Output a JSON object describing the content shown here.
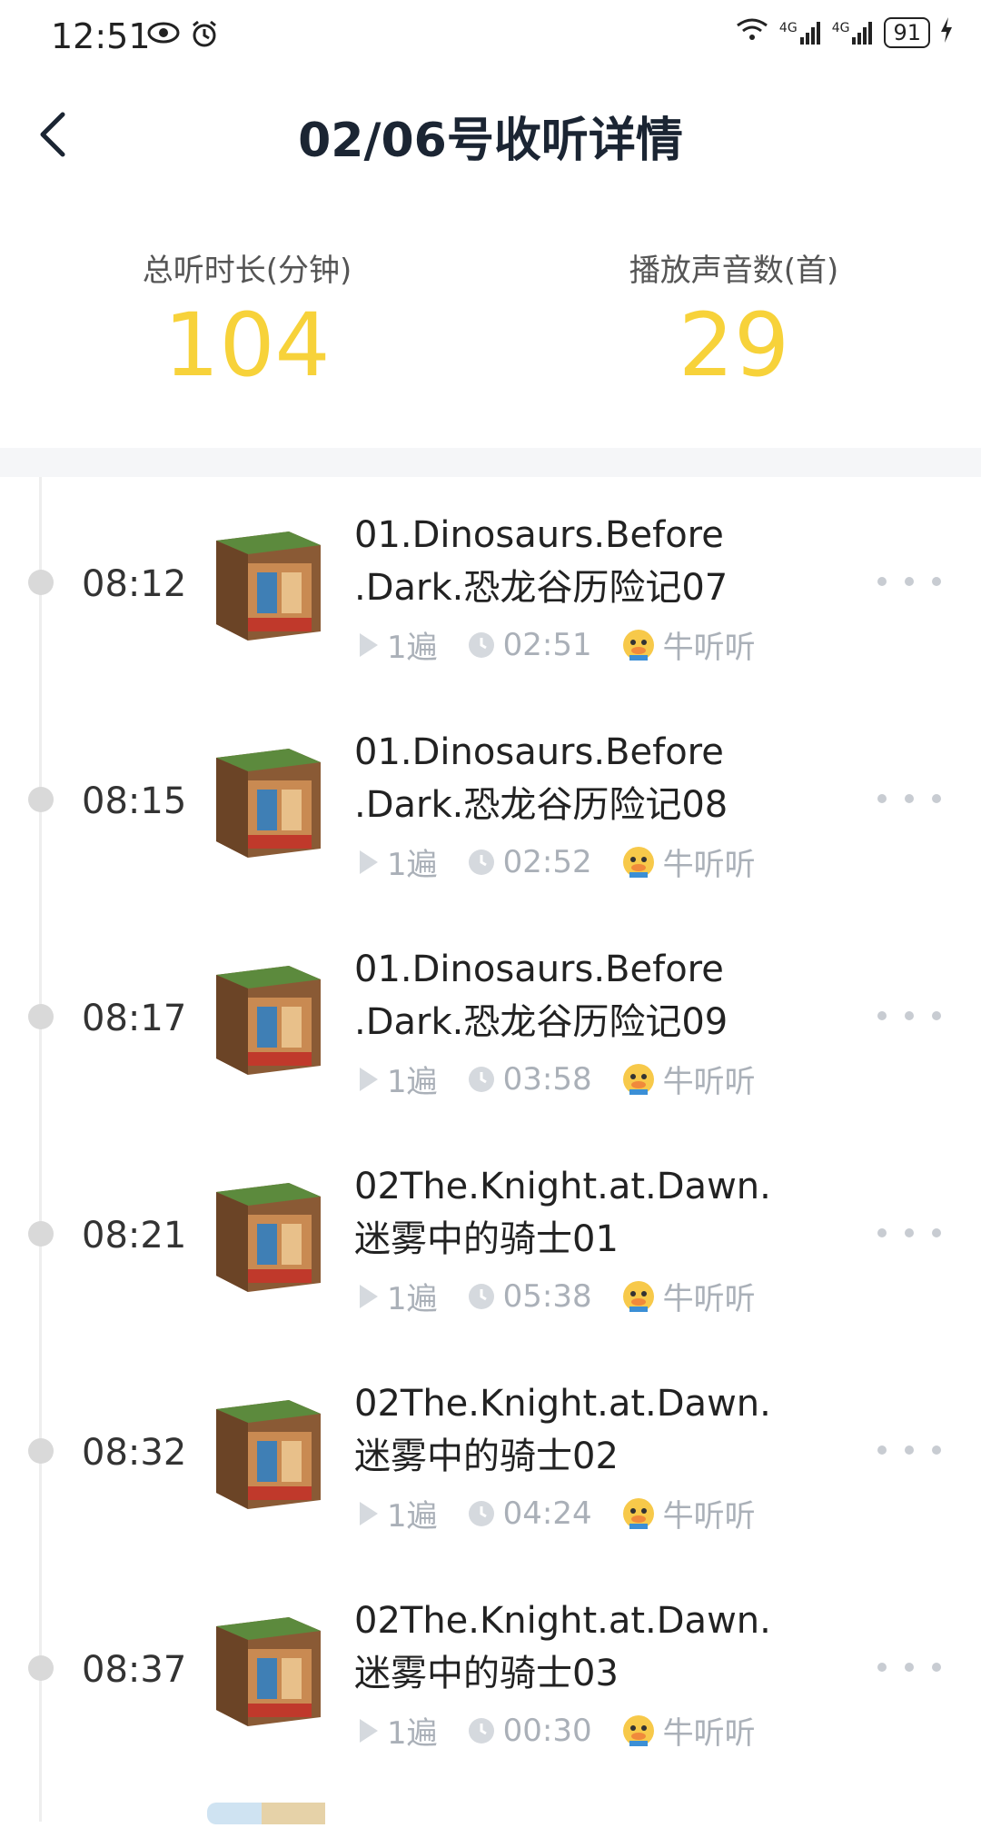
{
  "status_bar": {
    "time": "12:51",
    "network_1": "4G",
    "network_2": "4G",
    "battery": "91"
  },
  "header": {
    "title": "02/06号收听详情"
  },
  "stats": {
    "total_label": "总听时长(分钟)",
    "total_value": "104",
    "count_label": "播放声音数(首)",
    "count_value": "29"
  },
  "records": [
    {
      "time": "08:12",
      "title_line1": "01.Dinosaurs.Before",
      "title_line2": ".Dark.恐龙谷历险记07",
      "plays": "1遍",
      "duration": "02:51",
      "user": "牛听听"
    },
    {
      "time": "08:15",
      "title_line1": "01.Dinosaurs.Before",
      "title_line2": ".Dark.恐龙谷历险记08",
      "plays": "1遍",
      "duration": "02:52",
      "user": "牛听听"
    },
    {
      "time": "08:17",
      "title_line1": "01.Dinosaurs.Before",
      "title_line2": ".Dark.恐龙谷历险记09",
      "plays": "1遍",
      "duration": "03:58",
      "user": "牛听听"
    },
    {
      "time": "08:21",
      "title_line1": "02The.Knight.at.Dawn.",
      "title_line2": "迷雾中的骑士01",
      "plays": "1遍",
      "duration": "05:38",
      "user": "牛听听"
    },
    {
      "time": "08:32",
      "title_line1": "02The.Knight.at.Dawn.",
      "title_line2": "迷雾中的骑士02",
      "plays": "1遍",
      "duration": "04:24",
      "user": "牛听听"
    },
    {
      "time": "08:37",
      "title_line1": "02The.Knight.at.Dawn.",
      "title_line2": "迷雾中的骑士03",
      "plays": "1遍",
      "duration": "00:30",
      "user": "牛听听"
    }
  ],
  "colors": {
    "accent": "#f7d23a",
    "title": "#1b2533",
    "meta": "#aab0b8"
  }
}
